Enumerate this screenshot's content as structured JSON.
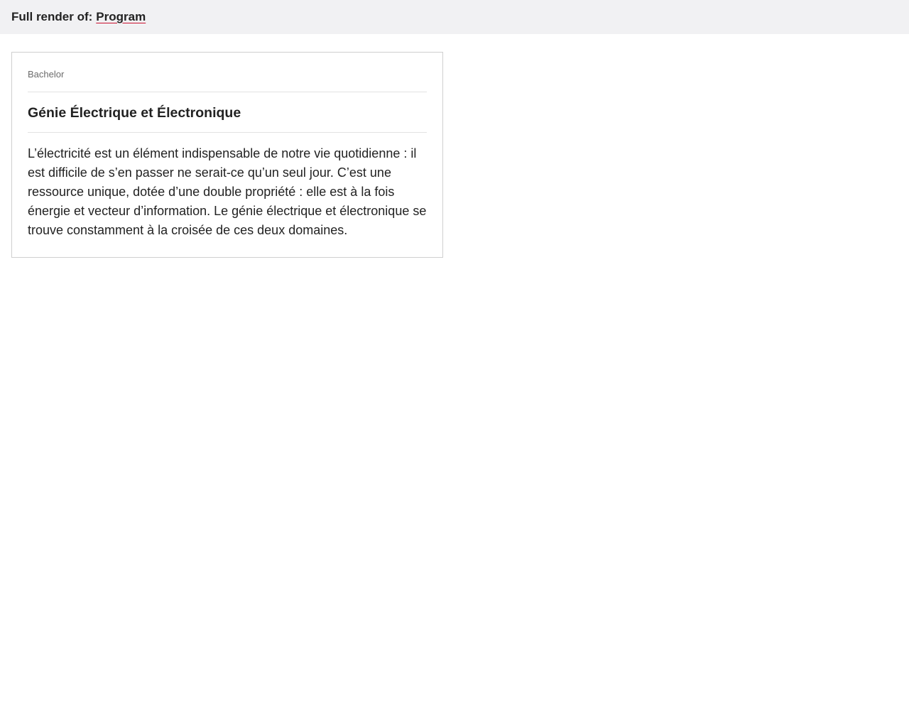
{
  "header": {
    "label": "Full render of:",
    "link_text": "Program"
  },
  "card": {
    "category": "Bachelor",
    "title": "Génie Électrique et Électronique",
    "description": "L’électricité est un élément indispensable de notre vie quotidienne : il est difficile de s’en passer ne serait-ce qu’un seul jour. C’est une ressource unique, dotée d’une double propriété : elle est à la fois énergie et vecteur d’information. Le génie électrique et électronique se trouve constamment à la croisée de ces deux domaines."
  },
  "colors": {
    "header_bg": "#f1f1f3",
    "link_underline": "#c8102e",
    "card_border": "#cfcfcf",
    "text": "#222222",
    "muted_text": "#6b6b6b"
  }
}
